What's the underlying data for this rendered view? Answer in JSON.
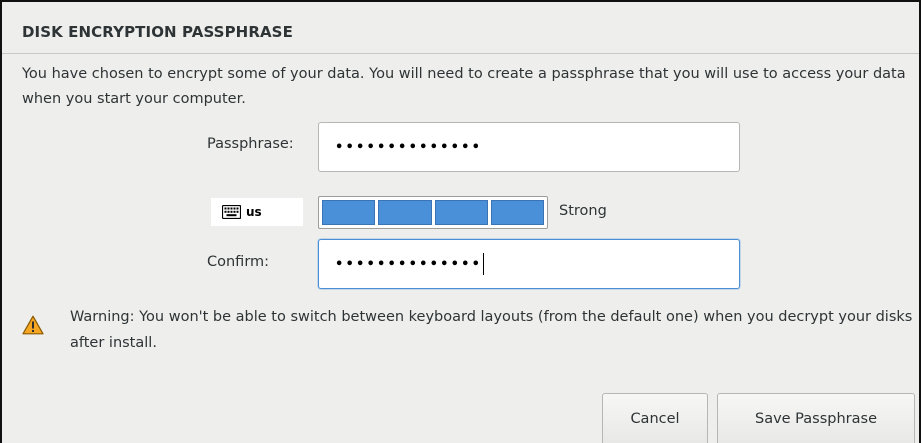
{
  "dialog": {
    "title": "DISK ENCRYPTION PASSPHRASE",
    "description": "You have chosen to encrypt some of your data. You will need to create a passphrase that you will use to access your data when you start your computer."
  },
  "passphrase": {
    "label": "Passphrase:",
    "masked_value": "••••••••••••••"
  },
  "keyboard": {
    "icon": "keyboard-icon",
    "layout": "us"
  },
  "strength": {
    "level": 4,
    "max_level": 4,
    "label": "Strong",
    "color": "#4a90d9"
  },
  "confirm": {
    "label": "Confirm:",
    "masked_value": "••••••••••••••"
  },
  "warning": {
    "icon": "warning-icon",
    "text": "Warning: You won't be able to switch between keyboard layouts (from the default one) when you decrypt your disks after install."
  },
  "buttons": {
    "cancel": "Cancel",
    "save": "Save Passphrase"
  }
}
